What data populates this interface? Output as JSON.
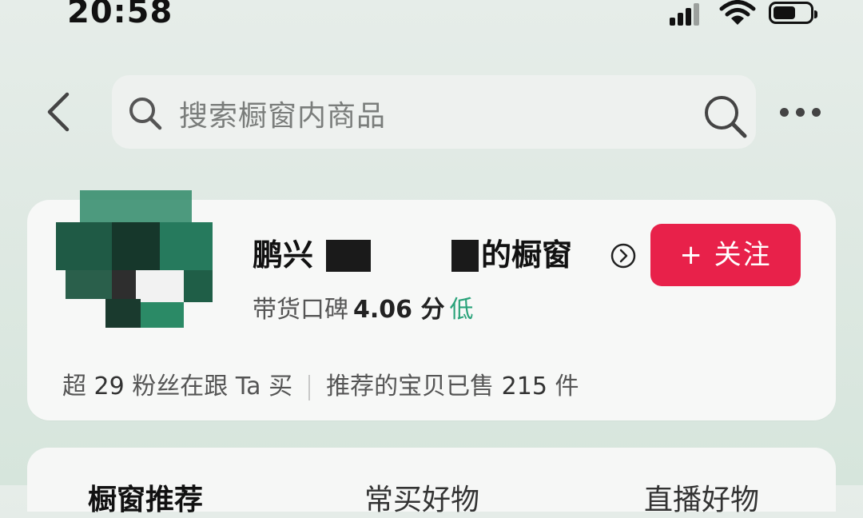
{
  "status_bar": {
    "time": "20:58"
  },
  "search": {
    "placeholder": "搜索橱窗内商品"
  },
  "shop": {
    "name_prefix": "鹏兴",
    "name_suffix": "的橱窗",
    "rating_label": "带货口碑",
    "rating_score": "4.06 分",
    "rating_level": "低",
    "follow_label": "+ 关注",
    "fans_prefix": "超",
    "fans_count": "29",
    "fans_suffix": "粉丝在跟 Ta 买",
    "sold_prefix": "推荐的宝贝已售",
    "sold_count": "215",
    "sold_suffix": "件"
  },
  "tabs": [
    {
      "label": "橱窗推荐",
      "active": true
    },
    {
      "label": "常买好物",
      "active": false
    },
    {
      "label": "直播好物",
      "active": false
    }
  ],
  "colors": {
    "follow": "#e8214a",
    "rating_level": "#2aa37a",
    "background": "#dfe9e3"
  }
}
